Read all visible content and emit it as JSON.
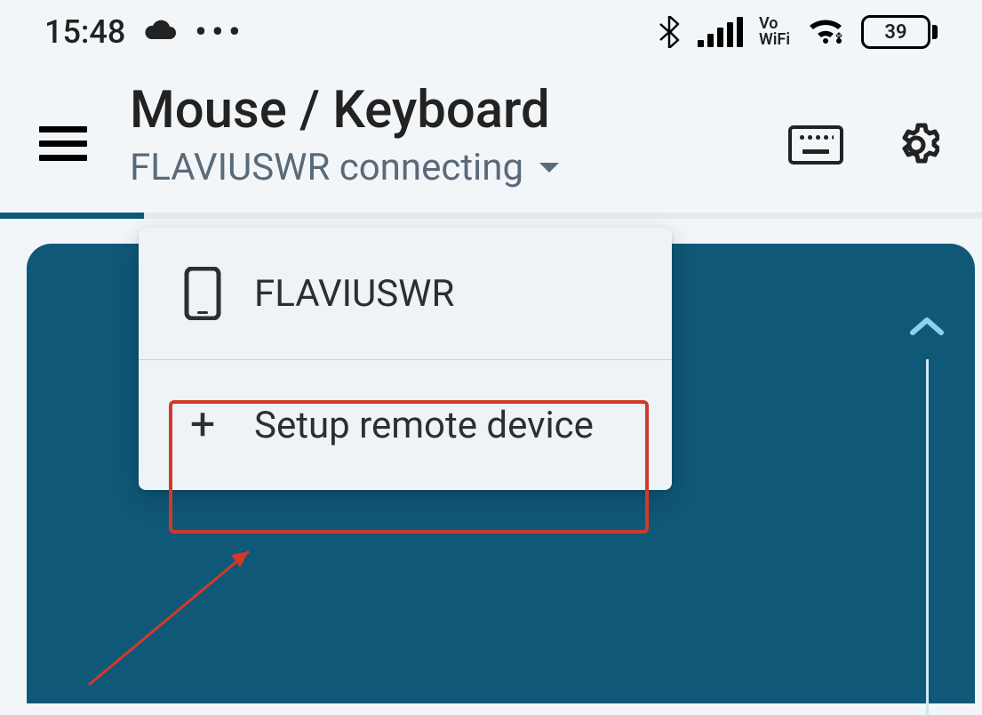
{
  "status_bar": {
    "time": "15:48",
    "dots": "•••",
    "vowifi_top": "Vo",
    "vowifi_bottom": "WiFi",
    "battery_level": "39"
  },
  "header": {
    "title": "Mouse / Keyboard",
    "subtitle": "FLAVIUSWR connecting"
  },
  "dropdown": {
    "items": [
      {
        "label": "FLAVIUSWR"
      },
      {
        "label": "Setup remote device"
      }
    ]
  }
}
